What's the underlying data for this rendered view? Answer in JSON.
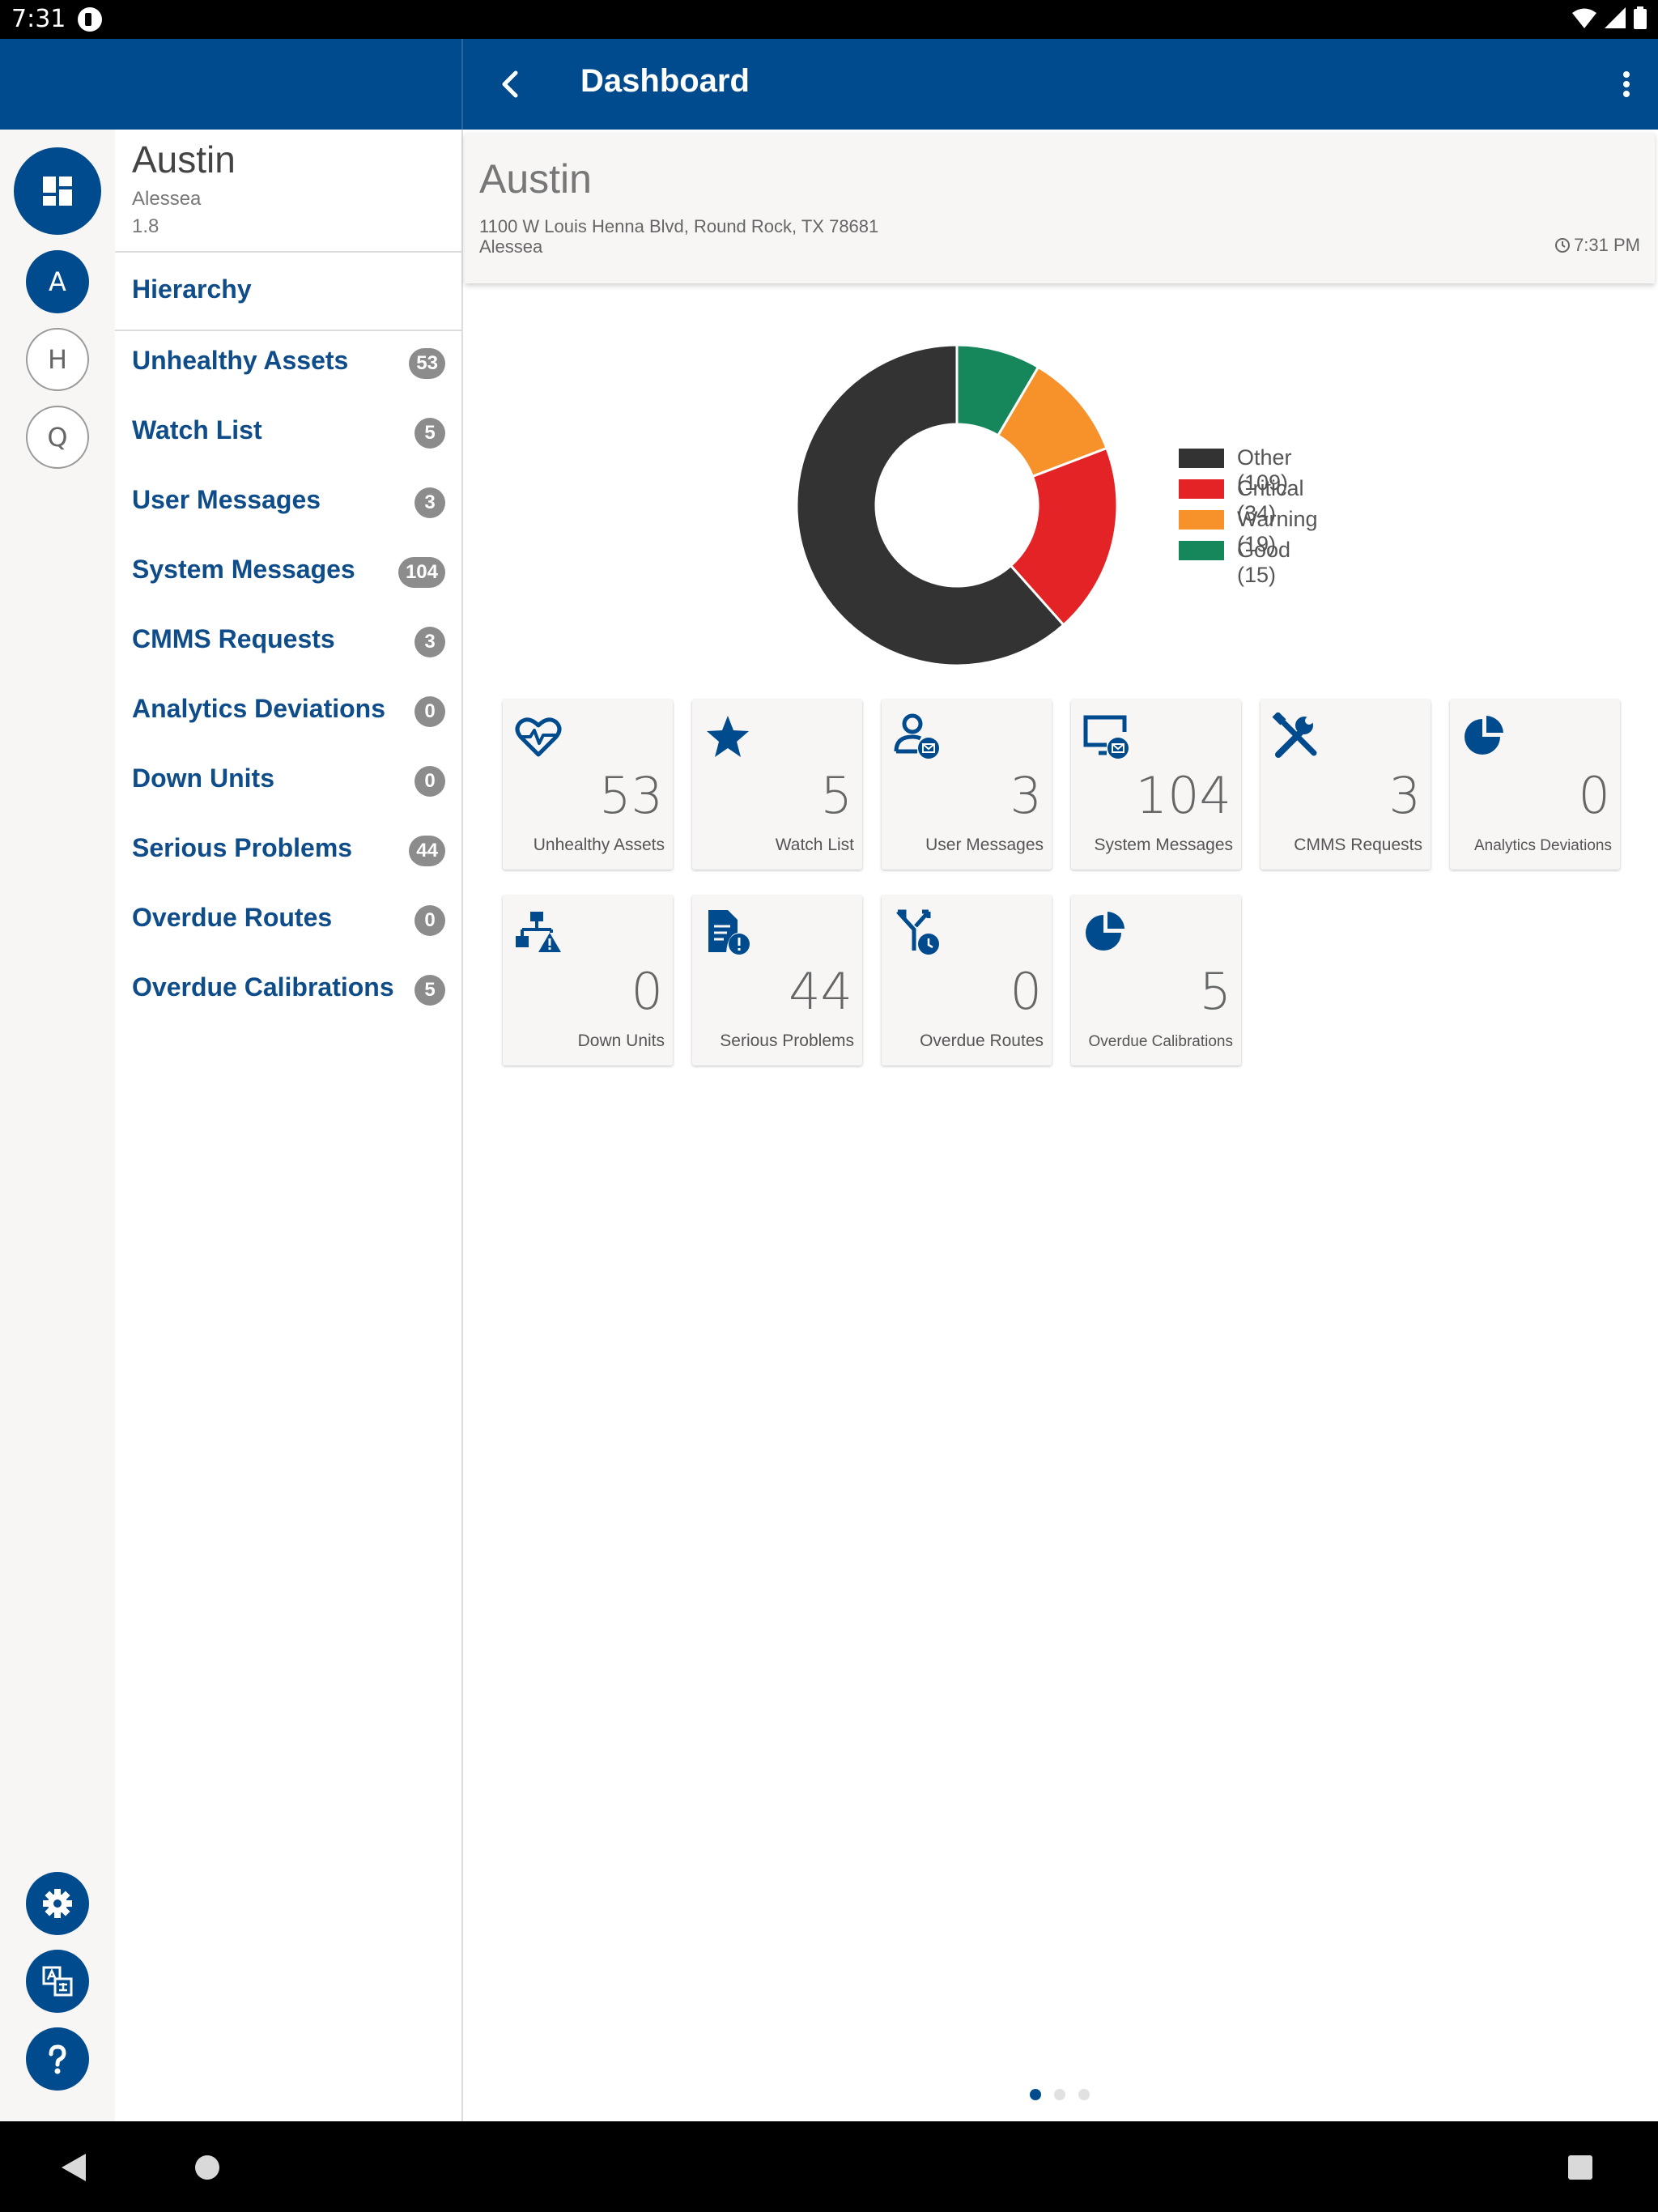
{
  "status_bar": {
    "time": "7:31"
  },
  "app_bar": {
    "title": "Dashboard"
  },
  "rail": {
    "letters": [
      "A",
      "H",
      "Q"
    ]
  },
  "left_panel": {
    "site_name": "Austin",
    "user": "Alessea",
    "version": "1.8",
    "hierarchy_label": "Hierarchy",
    "items": [
      {
        "label": "Unhealthy Assets",
        "count": "53"
      },
      {
        "label": "Watch List",
        "count": "5"
      },
      {
        "label": "User Messages",
        "count": "3"
      },
      {
        "label": "System Messages",
        "count": "104"
      },
      {
        "label": "CMMS Requests",
        "count": "3"
      },
      {
        "label": "Analytics Deviations",
        "count": "0"
      },
      {
        "label": "Down Units",
        "count": "0"
      },
      {
        "label": "Serious Problems",
        "count": "44"
      },
      {
        "label": "Overdue Routes",
        "count": "0"
      },
      {
        "label": "Overdue Calibrations",
        "count": "5"
      }
    ]
  },
  "header": {
    "title": "Austin",
    "address": "1100 W Louis Henna Blvd, Round Rock, TX 78681",
    "user": "Alessea",
    "time": "7:31 PM"
  },
  "chart_data": {
    "type": "pie",
    "slices": [
      {
        "label": "Other (109)",
        "value": 109,
        "color": "#333333"
      },
      {
        "label": "Critical (34)",
        "value": 34,
        "color": "#e42326"
      },
      {
        "label": "Warning (19)",
        "value": 19,
        "color": "#f7922b"
      },
      {
        "label": "Good (15)",
        "value": 15,
        "color": "#15875a"
      }
    ],
    "legend": "right"
  },
  "tiles": [
    {
      "value": "53",
      "label": "Unhealthy Assets",
      "icon": "heart-pulse-icon"
    },
    {
      "value": "5",
      "label": "Watch List",
      "icon": "star-icon"
    },
    {
      "value": "3",
      "label": "User Messages",
      "icon": "user-message-icon"
    },
    {
      "value": "104",
      "label": "System Messages",
      "icon": "monitor-message-icon"
    },
    {
      "value": "3",
      "label": "CMMS Requests",
      "icon": "tools-icon"
    },
    {
      "value": "0",
      "label": "Analytics Deviations",
      "icon": "pie-chart-icon"
    },
    {
      "value": "0",
      "label": "Down Units",
      "icon": "hierarchy-warning-icon"
    },
    {
      "value": "44",
      "label": "Serious Problems",
      "icon": "document-alert-icon"
    },
    {
      "value": "0",
      "label": "Overdue Routes",
      "icon": "route-clock-icon"
    },
    {
      "value": "5",
      "label": "Overdue Calibrations",
      "icon": "pie-chart-icon"
    }
  ],
  "colors": {
    "primary": "#004b8d",
    "badge": "#8c8c8c"
  }
}
